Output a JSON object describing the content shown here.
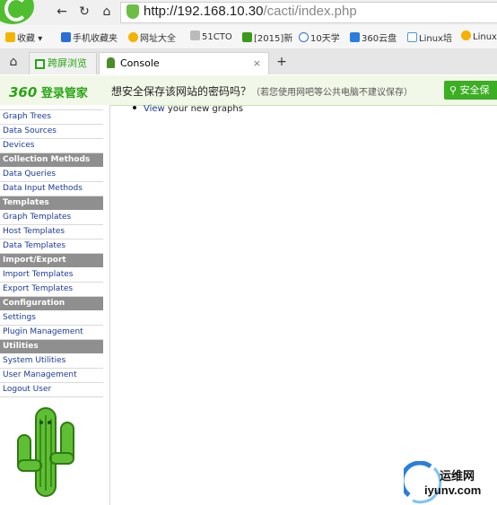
{
  "browser": {
    "url_host": "http://192.168.10.30",
    "url_path": "/cacti/index.php",
    "favorites": [
      "收藏",
      "手机收藏夹",
      "网址大全",
      "51CTO",
      "[2015]新",
      "10天学",
      "360云盘",
      "Linux培",
      "Linux"
    ],
    "tabs": {
      "split_view": "跨屏浏览",
      "active_title": "Console",
      "close_symbol": "×",
      "new_tab_symbol": "+"
    },
    "password_bar": {
      "brand_number": "360",
      "brand_text": "登录管家",
      "message": "想安全保存该网站的密码吗？",
      "note": "（若您使用网吧等公共电脑不建议保存）",
      "button": "安全保"
    }
  },
  "sidebar": {
    "menu": [
      {
        "type": "item",
        "label": "Graph Trees"
      },
      {
        "type": "item",
        "label": "Data Sources"
      },
      {
        "type": "item",
        "label": "Devices"
      },
      {
        "type": "head",
        "label": "Collection Methods"
      },
      {
        "type": "item",
        "label": "Data Queries"
      },
      {
        "type": "item",
        "label": "Data Input Methods"
      },
      {
        "type": "head",
        "label": "Templates"
      },
      {
        "type": "item",
        "label": "Graph Templates"
      },
      {
        "type": "item",
        "label": "Host Templates"
      },
      {
        "type": "item",
        "label": "Data Templates"
      },
      {
        "type": "head",
        "label": "Import/Export"
      },
      {
        "type": "item",
        "label": "Import Templates"
      },
      {
        "type": "item",
        "label": "Export Templates"
      },
      {
        "type": "head",
        "label": "Configuration"
      },
      {
        "type": "item",
        "label": "Settings"
      },
      {
        "type": "item",
        "label": "Plugin Management"
      },
      {
        "type": "head",
        "label": "Utilities"
      },
      {
        "type": "item",
        "label": "System Utilities"
      },
      {
        "type": "item",
        "label": "User Management"
      },
      {
        "type": "item",
        "label": "Logout User"
      }
    ]
  },
  "main": {
    "link": "View",
    "text": " your new graphs"
  },
  "watermark": {
    "cn": "运维网",
    "en": "iyunv.com"
  }
}
